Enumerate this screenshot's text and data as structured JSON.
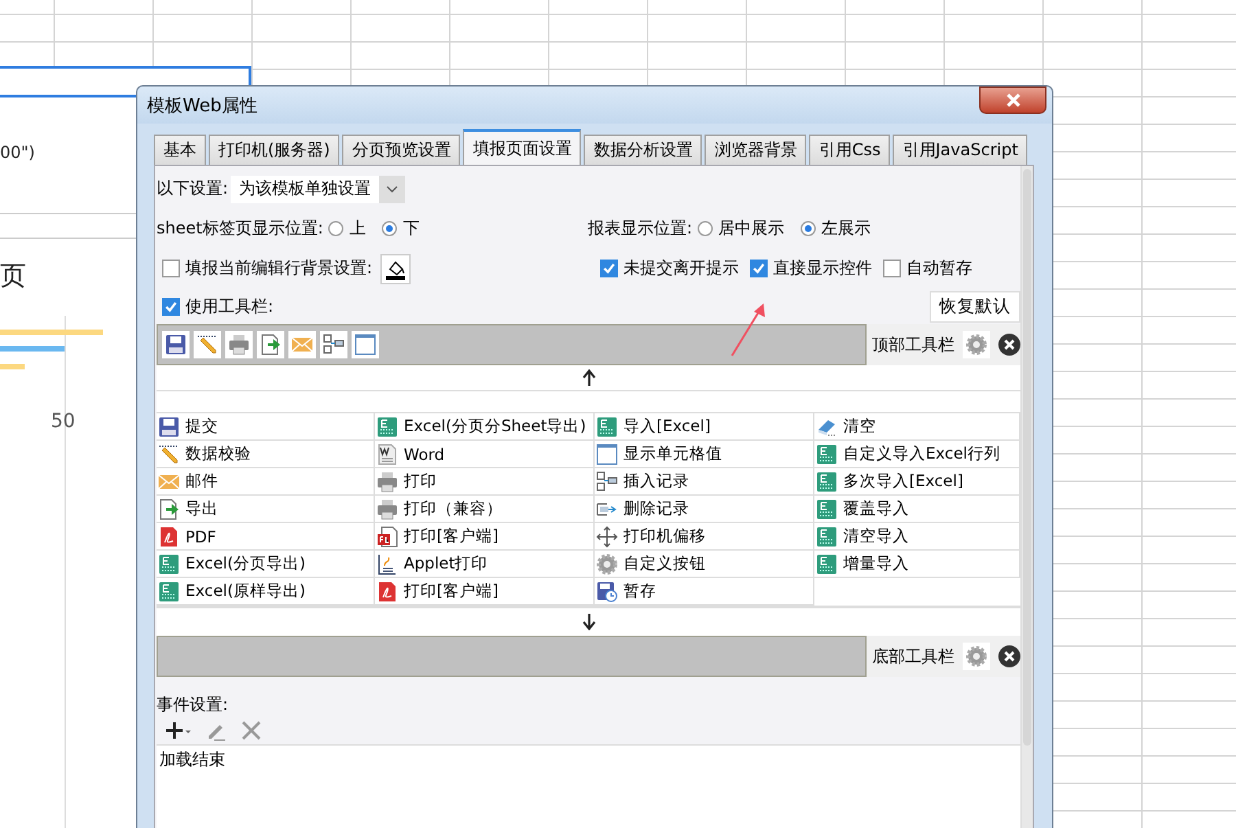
{
  "spreadsheet": {
    "texts": [
      "00\")",
      "页",
      "50"
    ]
  },
  "window": {
    "title": "模板Web属性"
  },
  "tabs": [
    {
      "label": "基本",
      "selected": false
    },
    {
      "label": "打印机(服务器)",
      "selected": false
    },
    {
      "label": "分页预览设置",
      "selected": false
    },
    {
      "label": "填报页面设置",
      "selected": true
    },
    {
      "label": "数据分析设置",
      "selected": false
    },
    {
      "label": "浏览器背景",
      "selected": false
    },
    {
      "label": "引用Css",
      "selected": false
    },
    {
      "label": "引用JavaScript",
      "selected": false
    }
  ],
  "scope": {
    "label": "以下设置:",
    "value": "为该模板单独设置"
  },
  "sheet_tab_position": {
    "label": "sheet标签页显示位置:",
    "options": [
      {
        "label": "上",
        "selected": false
      },
      {
        "label": "下",
        "selected": true
      }
    ]
  },
  "report_position": {
    "label": "报表显示位置:",
    "options": [
      {
        "label": "居中展示",
        "selected": false
      },
      {
        "label": "左展示",
        "selected": true
      }
    ]
  },
  "row_background": {
    "label": "填报当前编辑行背景设置:",
    "checked": false
  },
  "options": [
    {
      "label": "未提交离开提示",
      "checked": true
    },
    {
      "label": "直接显示控件",
      "checked": true
    },
    {
      "label": "自动暂存",
      "checked": false
    }
  ],
  "use_toolbar": {
    "label": "使用工具栏:",
    "checked": true
  },
  "restore_button": "恢复默认",
  "top_toolbar": {
    "label": "顶部工具栏",
    "buttons": [
      {
        "kind": "save"
      },
      {
        "kind": "pencil"
      },
      {
        "kind": "print"
      },
      {
        "kind": "export"
      },
      {
        "kind": "mail"
      },
      {
        "kind": "insert"
      },
      {
        "kind": "cell"
      }
    ]
  },
  "available_buttons": {
    "columns": [
      [
        {
          "kind": "save",
          "label": "提交"
        },
        {
          "kind": "pencil",
          "label": "数据校验"
        },
        {
          "kind": "mail",
          "label": "邮件"
        },
        {
          "kind": "export",
          "label": "导出"
        },
        {
          "kind": "pdf",
          "label": "PDF"
        },
        {
          "kind": "excel",
          "label": "Excel(分页导出)"
        },
        {
          "kind": "excel",
          "label": "Excel(原样导出)"
        }
      ],
      [
        {
          "kind": "excel",
          "label": "Excel(分页分Sheet导出)"
        },
        {
          "kind": "word",
          "label": "Word"
        },
        {
          "kind": "print",
          "label": "打印"
        },
        {
          "kind": "print",
          "label": "打印（兼容）"
        },
        {
          "kind": "fl",
          "label": "打印[客户端]"
        },
        {
          "kind": "applet",
          "label": "Applet打印"
        },
        {
          "kind": "pdf",
          "label": "打印[客户端]"
        }
      ],
      [
        {
          "kind": "excel",
          "label": "导入[Excel]"
        },
        {
          "kind": "cell",
          "label": "显示单元格值"
        },
        {
          "kind": "insert",
          "label": "插入记录"
        },
        {
          "kind": "delete",
          "label": "删除记录"
        },
        {
          "kind": "move",
          "label": "打印机偏移"
        },
        {
          "kind": "gear",
          "label": "自定义按钮"
        },
        {
          "kind": "savetime",
          "label": "暂存"
        }
      ],
      [
        {
          "kind": "eraser",
          "label": "清空"
        },
        {
          "kind": "excel",
          "label": "自定义导入Excel行列"
        },
        {
          "kind": "excel",
          "label": "多次导入[Excel]"
        },
        {
          "kind": "excel",
          "label": "覆盖导入"
        },
        {
          "kind": "excel",
          "label": "清空导入"
        },
        {
          "kind": "excel",
          "label": "增量导入"
        }
      ]
    ]
  },
  "bottom_toolbar": {
    "label": "底部工具栏"
  },
  "events": {
    "label": "事件设置:",
    "items": [
      "加载结束"
    ]
  }
}
